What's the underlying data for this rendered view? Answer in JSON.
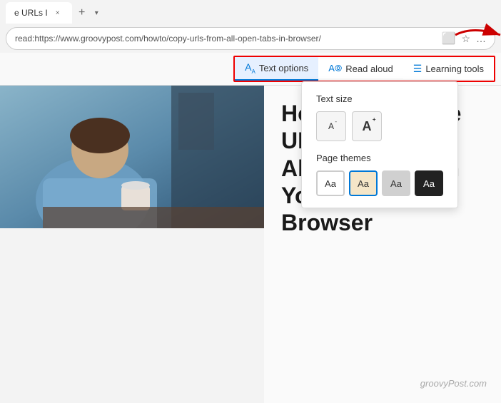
{
  "browser": {
    "tab_title": "e URLs I",
    "tab_close": "×",
    "new_tab": "+",
    "tab_dropdown": "▾",
    "address": "read:https://www.groovypost.com/howto/copy-urls-from-all-open-tabs-in-browser/",
    "icon_immersive": "▣",
    "icon_star": "☆",
    "icon_settings": "…"
  },
  "toolbar": {
    "text_options_label": "Text options",
    "read_aloud_label": "Read aloud",
    "learning_tools_label": "Learning tools"
  },
  "text_options_panel": {
    "text_size_title": "Text size",
    "decrease_label": "A",
    "increase_label": "A",
    "page_themes_title": "Page themes",
    "theme_white_label": "Aa",
    "theme_beige_label": "Aa",
    "theme_gray_label": "Aa",
    "theme_dark_label": "Aa"
  },
  "article": {
    "title_line1": "How to Copy the URLs From",
    "title_line2": "All Open Tabs in Your",
    "title_line3": "Browser",
    "watermark": "groovyPost.com"
  }
}
